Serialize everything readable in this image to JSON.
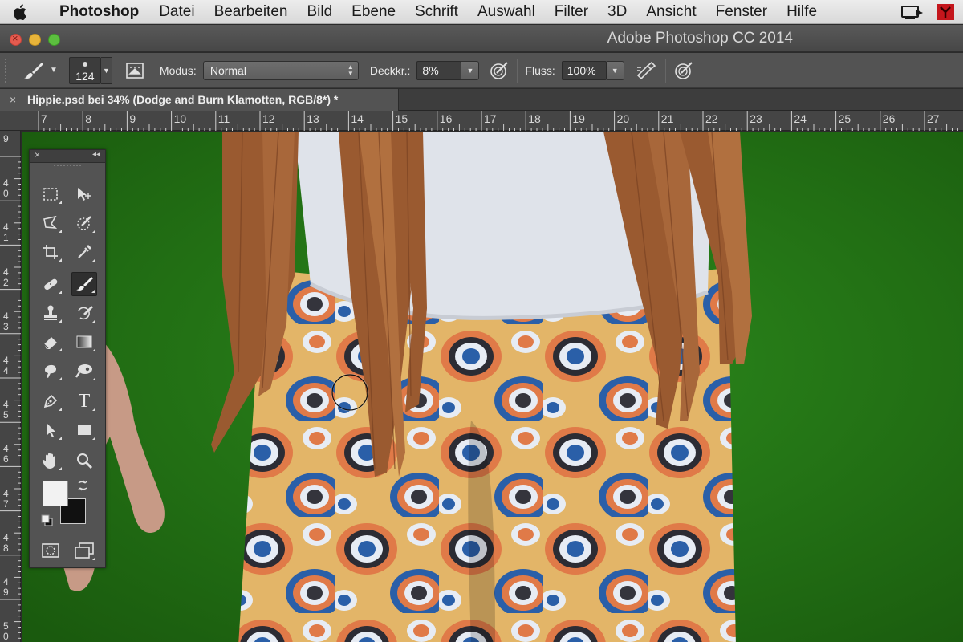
{
  "menubar": {
    "app_name": "Photoshop",
    "items": [
      "Datei",
      "Bearbeiten",
      "Bild",
      "Ebene",
      "Schrift",
      "Auswahl",
      "Filter",
      "3D",
      "Ansicht",
      "Fenster",
      "Hilfe"
    ]
  },
  "window": {
    "title": "Adobe Photoshop CC 2014"
  },
  "options": {
    "brush_size": "124",
    "mode_label": "Modus:",
    "mode_value": "Normal",
    "opacity_label": "Deckkr.:",
    "opacity_value": "8%",
    "flow_label": "Fluss:",
    "flow_value": "100%"
  },
  "document_tab": {
    "close": "×",
    "title": "Hippie.psd bei 34% (Dodge and Burn Klamotten, RGB/8*) *"
  },
  "ruler_h": [
    "7",
    "8",
    "9",
    "10",
    "11",
    "12",
    "13",
    "14",
    "15",
    "16",
    "17",
    "18",
    "19",
    "20",
    "21",
    "22",
    "23",
    "24",
    "25",
    "26",
    "27"
  ],
  "ruler_v": [
    {
      "top": "",
      "bottom": "9"
    },
    {
      "top": "4",
      "bottom": "0"
    },
    {
      "top": "4",
      "bottom": "1"
    },
    {
      "top": "4",
      "bottom": "2"
    },
    {
      "top": "4",
      "bottom": "3"
    },
    {
      "top": "4",
      "bottom": "4"
    },
    {
      "top": "4",
      "bottom": "5"
    },
    {
      "top": "4",
      "bottom": "6"
    },
    {
      "top": "4",
      "bottom": "7"
    },
    {
      "top": "4",
      "bottom": "8"
    },
    {
      "top": "4",
      "bottom": "9"
    },
    {
      "top": "5",
      "bottom": "0"
    }
  ],
  "tools_panel": {
    "close": "×",
    "collapse": "◂◂",
    "type_tool_glyph": "T"
  },
  "colors": {
    "background_green": "#1f6a12",
    "vest_brown": "#9a5a30",
    "shirt_white": "#dfe3ea",
    "pants_orange": "#e07a48",
    "pants_blue": "#2a5fa8",
    "pants_yellow": "#e3b568"
  }
}
